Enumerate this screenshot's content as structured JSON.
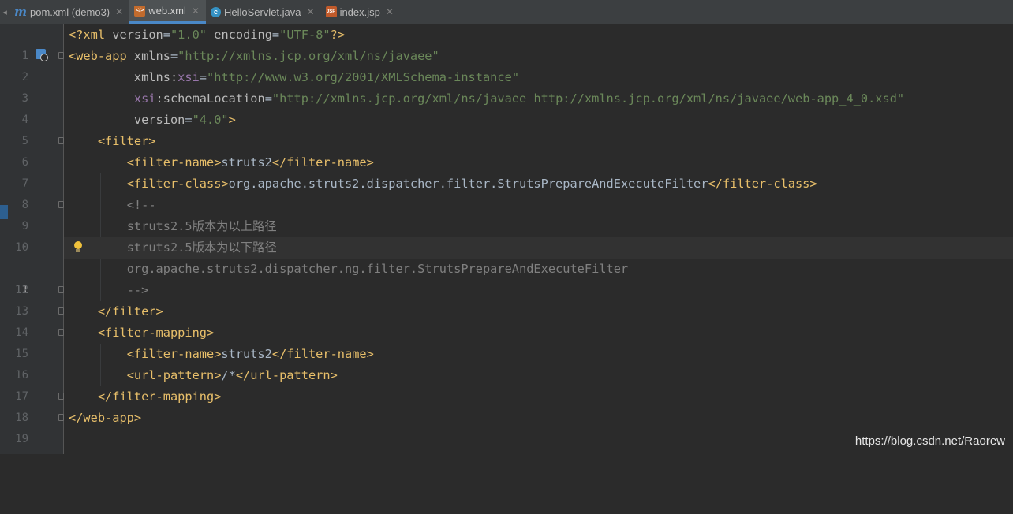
{
  "tabs": [
    {
      "label": "pom.xml (demo3)",
      "icon": "maven-icon",
      "active": false
    },
    {
      "label": "web.xml",
      "icon": "xml-file-icon",
      "active": true
    },
    {
      "label": "HelloServlet.java",
      "icon": "java-class-icon",
      "active": false
    },
    {
      "label": "index.jsp",
      "icon": "jsp-file-icon",
      "active": false
    }
  ],
  "editor": {
    "current_line": 11,
    "lines": [
      {
        "n": "1"
      },
      {
        "n": "2"
      },
      {
        "n": "3"
      },
      {
        "n": "4"
      },
      {
        "n": "5"
      },
      {
        "n": "6"
      },
      {
        "n": "7"
      },
      {
        "n": "8"
      },
      {
        "n": "9"
      },
      {
        "n": "10"
      },
      {
        "n": "11"
      },
      {
        "n": "12"
      },
      {
        "n": "13"
      },
      {
        "n": "14"
      },
      {
        "n": "15"
      },
      {
        "n": "16"
      },
      {
        "n": "17"
      },
      {
        "n": "18"
      },
      {
        "n": "19"
      }
    ],
    "code": {
      "l1": {
        "p1": "<?xml ",
        "a1": "version",
        "e1": "=",
        "v1": "\"1.0\"",
        "sp": " ",
        "a2": "encoding",
        "e2": "=",
        "v2": "\"UTF-8\"",
        "p2": "?>"
      },
      "l2": {
        "t1": "<web-app ",
        "a1": "xmlns",
        "e1": "=",
        "v1": "\"http://xmlns.jcp.org/xml/ns/javaee\""
      },
      "l3": {
        "ind": "         ",
        "a1": "xmlns:",
        "ns": "xsi",
        "e1": "=",
        "v1": "\"http://www.w3.org/2001/XMLSchema-instance\""
      },
      "l4": {
        "ind": "         ",
        "ns": "xsi",
        "a1": ":schemaLocation",
        "e1": "=",
        "v1": "\"http://xmlns.jcp.org/xml/ns/javaee http://xmlns.jcp.org/xml/ns/javaee/web-app_4_0.xsd\""
      },
      "l5": {
        "ind": "         ",
        "a1": "version",
        "e1": "=",
        "v1": "\"4.0\"",
        "t1": ">"
      },
      "l6": {
        "ind": "    ",
        "t1": "<filter>"
      },
      "l7": {
        "ind": "        ",
        "t1": "<filter-name>",
        "x1": "struts2",
        "t2": "</filter-name>"
      },
      "l8": {
        "ind": "        ",
        "t1": "<filter-class>",
        "x1": "org.apache.struts2.dispatcher.filter.StrutsPrepareAndExecuteFilter",
        "t2": "</filter-class>"
      },
      "l9": {
        "ind": "        ",
        "c1": "<!--"
      },
      "l10": {
        "ind": "        ",
        "c1": "struts2.5版本为以上路径"
      },
      "l11": {
        "ind": "        ",
        "c1": "struts2.5版本为以下路径"
      },
      "l12": {
        "ind": "        ",
        "c1": "org.apache.struts2.dispatcher.ng.filter.StrutsPrepareAndExecuteFilter"
      },
      "l13": {
        "ind": "        ",
        "c1": "-->"
      },
      "l14": {
        "ind": "    ",
        "t1": "</filter>"
      },
      "l15": {
        "ind": "    ",
        "t1": "<filter-mapping>"
      },
      "l16": {
        "ind": "        ",
        "t1": "<filter-name>",
        "x1": "struts2",
        "t2": "</filter-name>"
      },
      "l17": {
        "ind": "        ",
        "t1": "<url-pattern>",
        "x1": "/*",
        "t2": "</url-pattern>"
      },
      "l18": {
        "ind": "    ",
        "t1": "</filter-mapping>"
      },
      "l19": {
        "t1": "</web-app>"
      }
    }
  },
  "watermark": "https://blog.csdn.net/Raorew",
  "colors": {
    "background": "#2b2b2b",
    "gutter": "#313335",
    "tag": "#e8bf6a",
    "attribute": "#bababa",
    "namespace": "#9876aa",
    "value": "#6a8759",
    "comment": "#808080",
    "active_tab_underline": "#4a88c7"
  }
}
